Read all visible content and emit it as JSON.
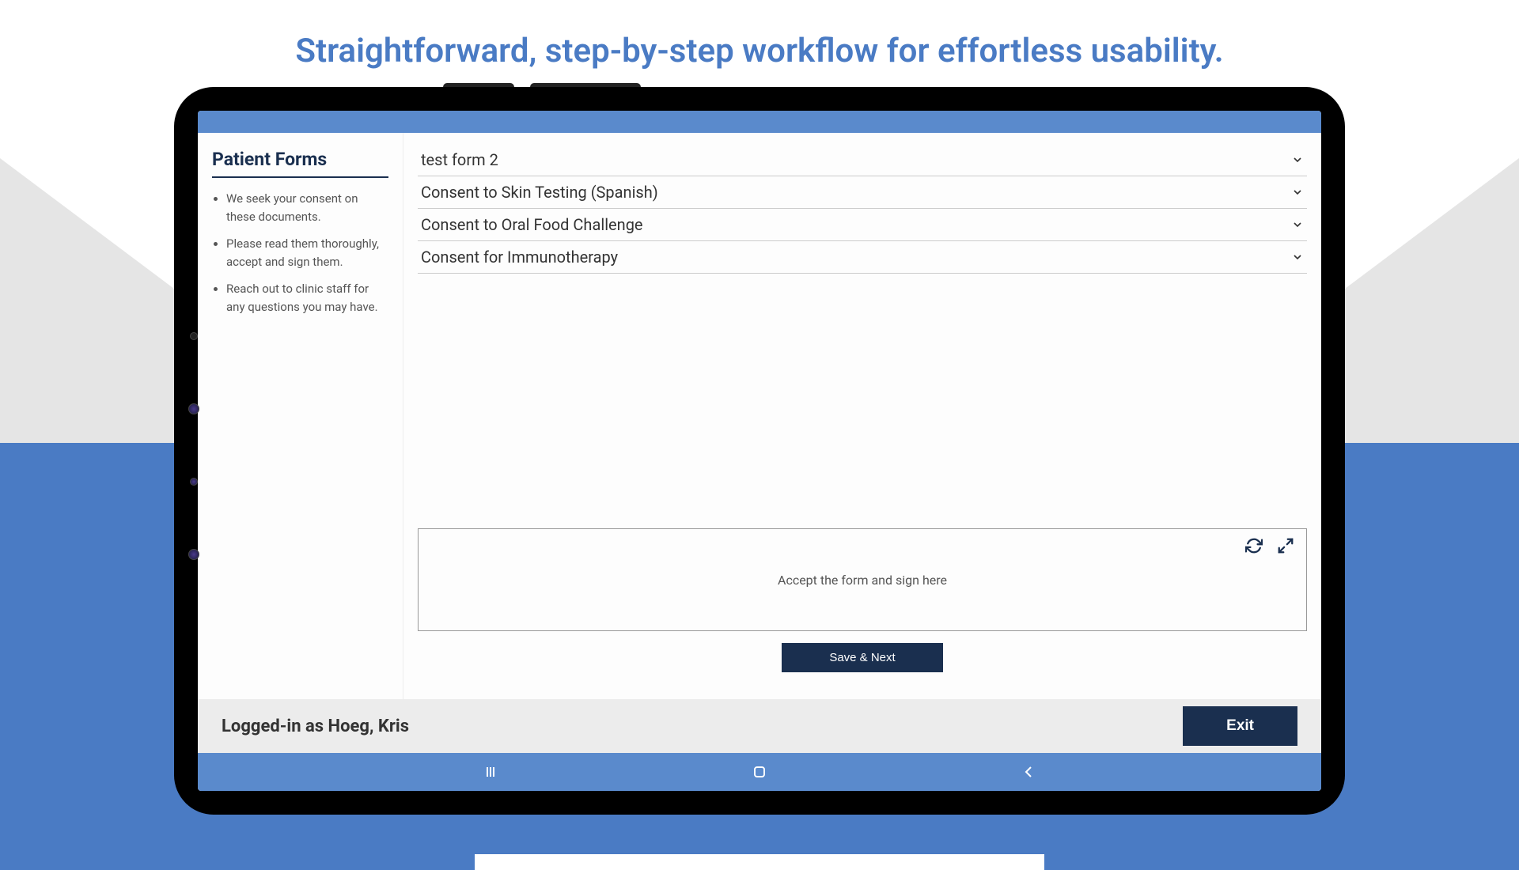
{
  "headline": "Straightforward, step-by-step workflow for effortless usability.",
  "sidebar": {
    "title": "Patient Forms",
    "instructions": [
      "We seek your consent on these documents.",
      "Please read them thoroughly, accept and sign them.",
      "Reach out to clinic staff for any questions you may have."
    ]
  },
  "forms": [
    {
      "label": "test form 2"
    },
    {
      "label": "Consent to Skin Testing (Spanish)"
    },
    {
      "label": "Consent to Oral Food Challenge"
    },
    {
      "label": "Consent for Immunotherapy"
    }
  ],
  "signature": {
    "placeholder": "Accept the form and sign here"
  },
  "buttons": {
    "save_next": "Save & Next",
    "exit": "Exit"
  },
  "footer": {
    "logged_in": "Logged-in as Hoeg, Kris"
  },
  "colors": {
    "primary_blue": "#4a7bc4",
    "dark_navy": "#1a2f4f",
    "header_blue": "#5a8acc"
  }
}
